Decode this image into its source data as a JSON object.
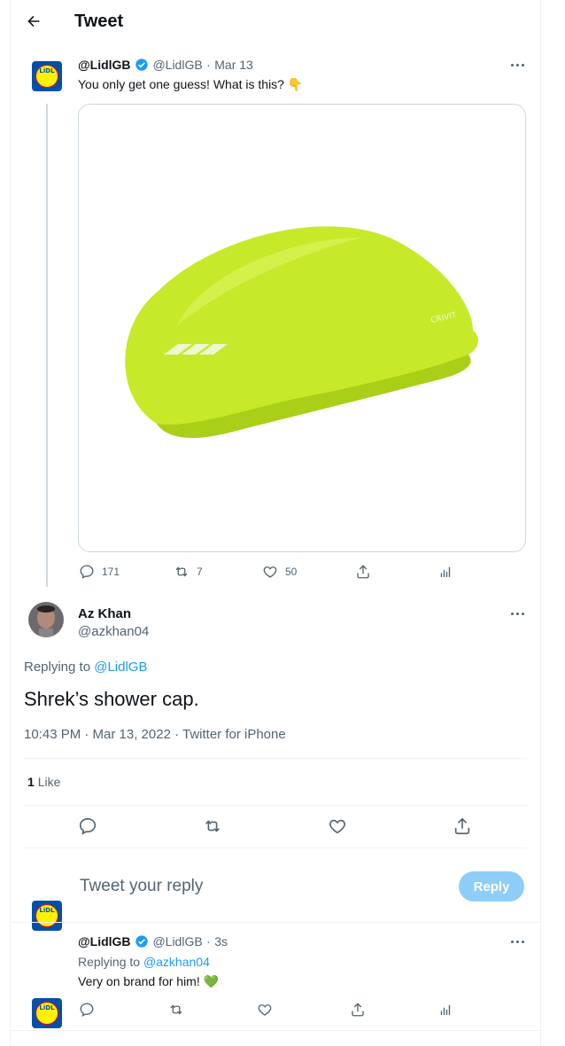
{
  "header": {
    "title": "Tweet"
  },
  "original_tweet": {
    "display_name": "@LidlGB",
    "handle": "@LidlGB",
    "date_sep": "·",
    "date": "Mar 13",
    "text": "You only get one guess! What is this? 👇",
    "stats": {
      "replies": "171",
      "retweets": "7",
      "likes": "50"
    }
  },
  "main_tweet": {
    "display_name": "Az Khan",
    "handle": "@azkhan04",
    "replying_prefix": "Replying to",
    "replying_to": "@LidlGB",
    "text": "Shrek’s shower cap.",
    "timestamp": "10:43 PM · Mar 13, 2022 · Twitter for iPhone",
    "likes_count": "1",
    "likes_label": "Like"
  },
  "composer": {
    "placeholder": "Tweet your reply",
    "button_label": "Reply"
  },
  "reply_tweet": {
    "display_name": "@LidlGB",
    "handle": "@LidlGB",
    "date_sep": "·",
    "date": "3s",
    "replying_prefix": "Replying to",
    "replying_to": "@azkhan04",
    "text": "Very on brand for him! 💚"
  },
  "logo": {
    "text": "LiDL"
  },
  "colors": {
    "accent": "#1d9bf0",
    "secondary": "#536471",
    "reply_button": "#8ecdf8",
    "cap": "#c6e92a"
  }
}
